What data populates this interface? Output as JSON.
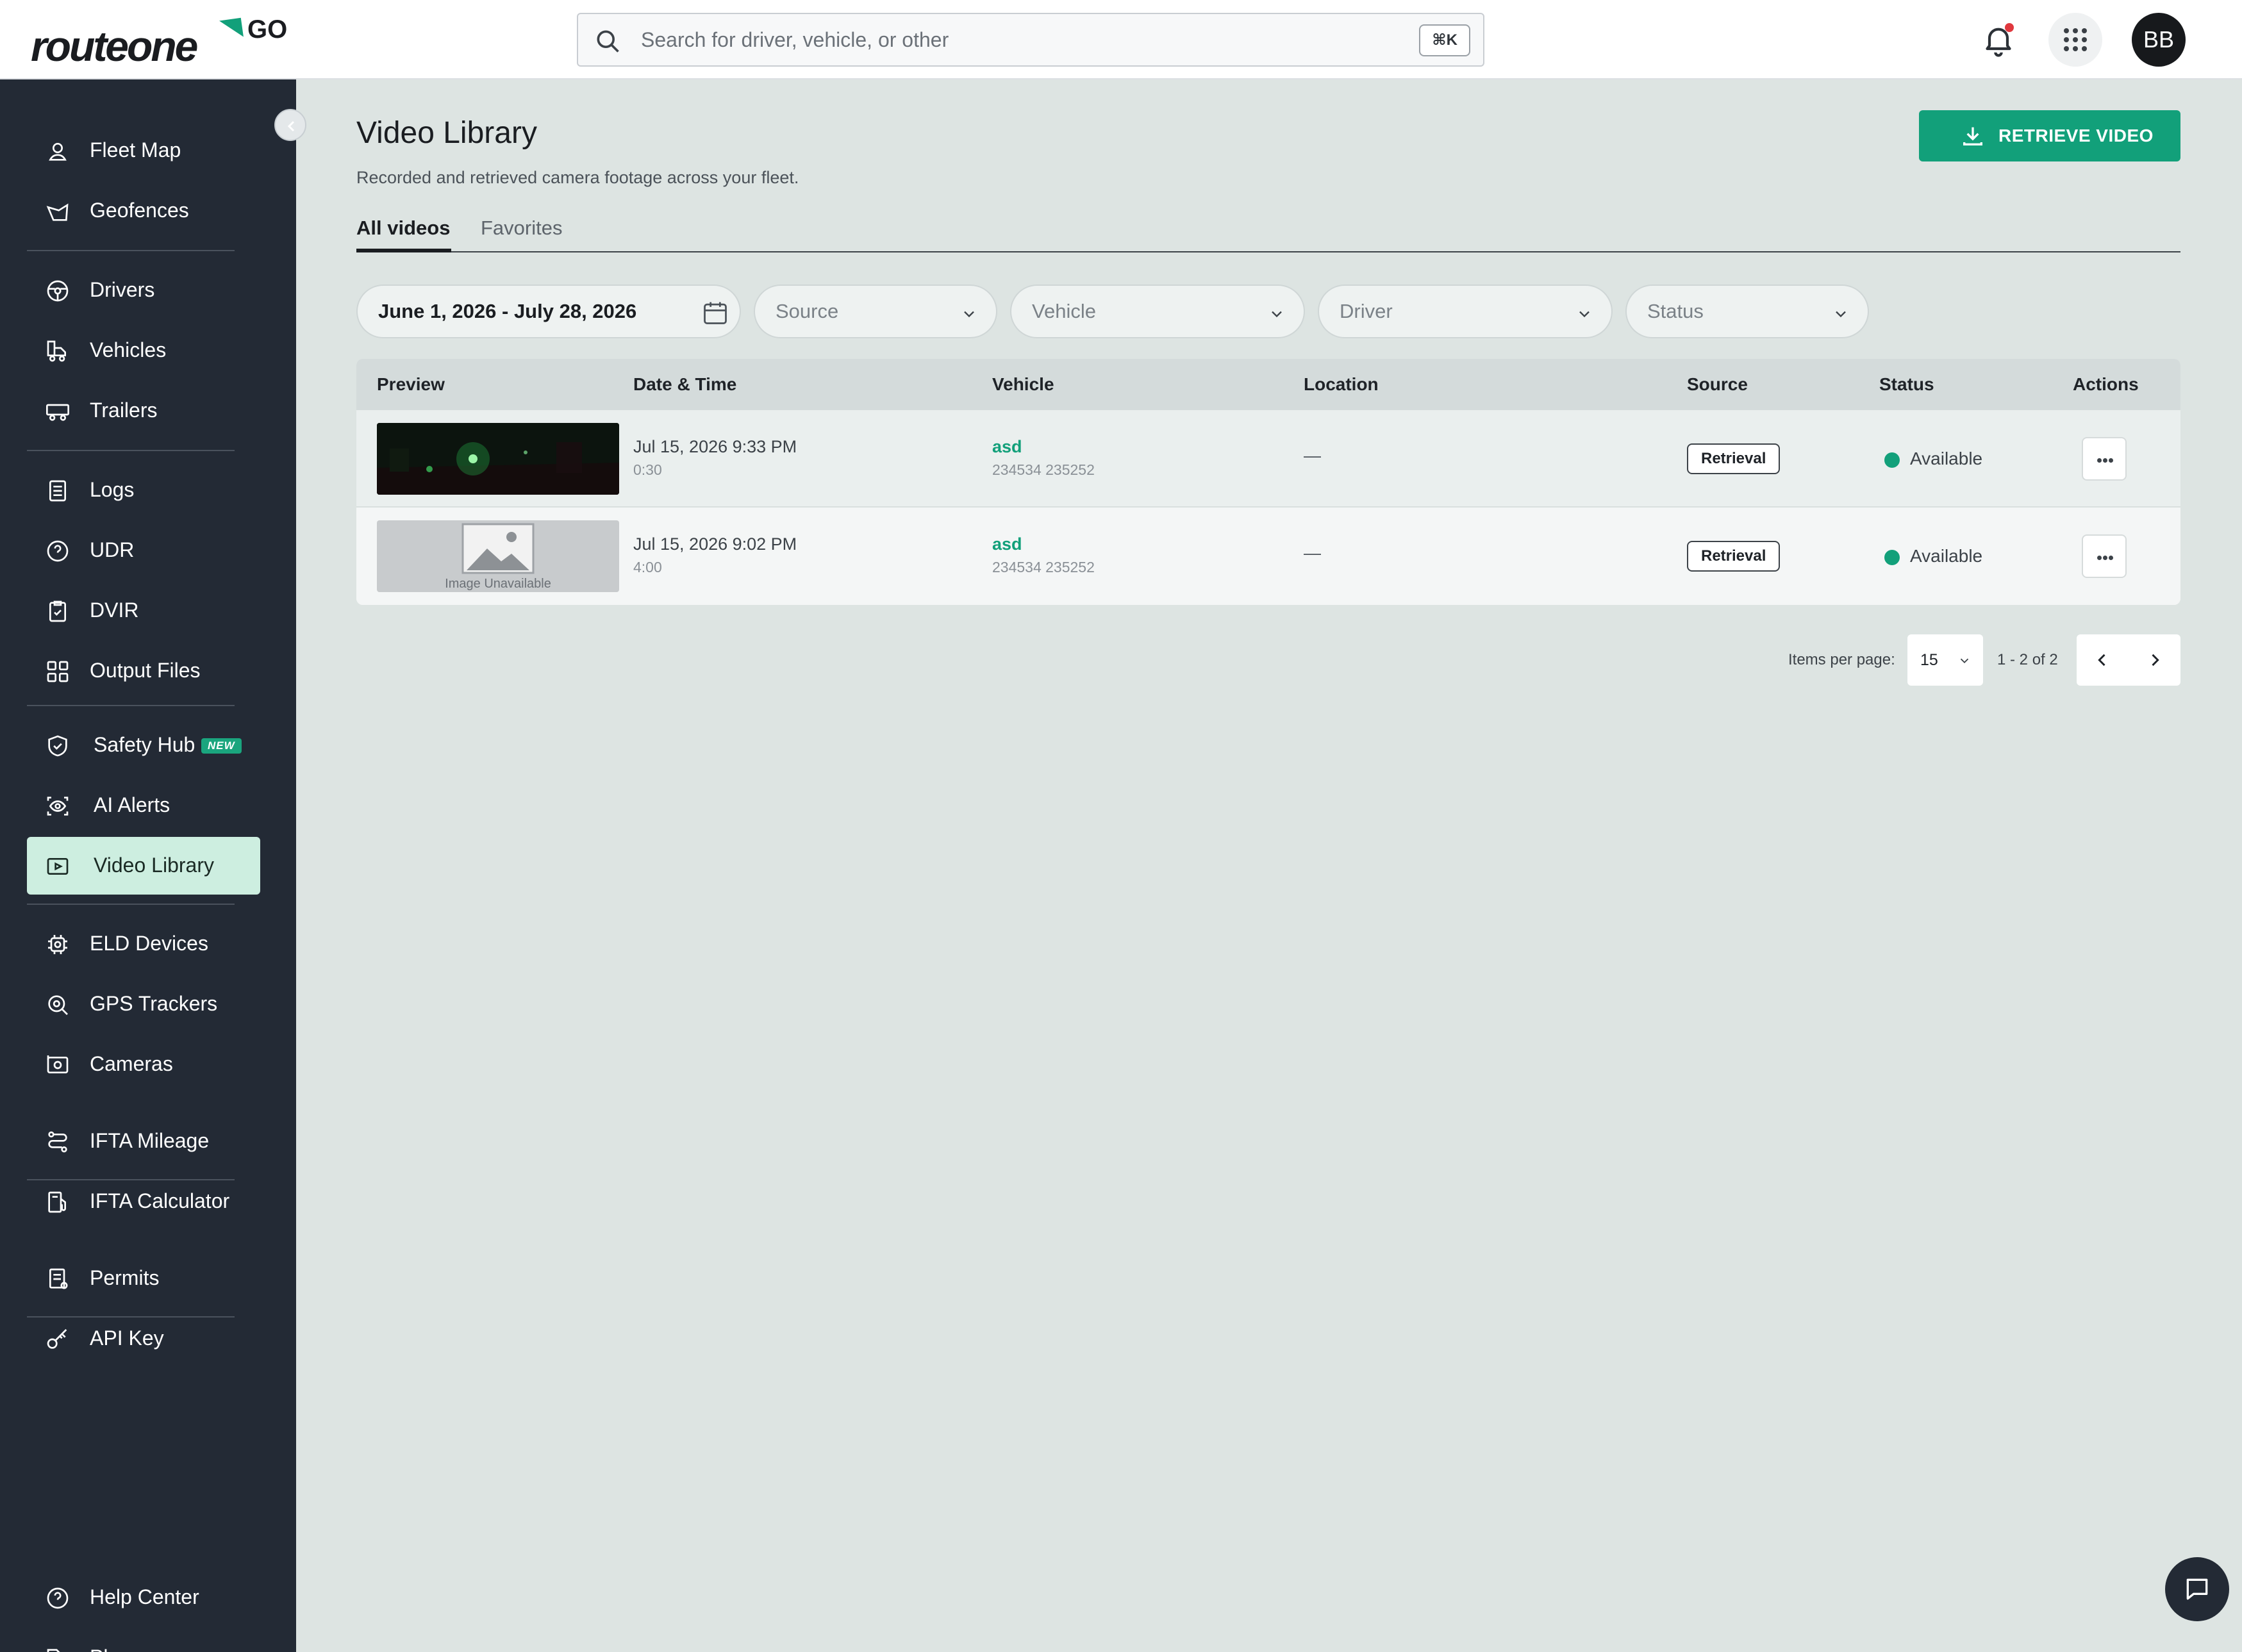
{
  "brand": {
    "wordmark": "routeone",
    "suffix": "GO",
    "accent": "#12a07a"
  },
  "search": {
    "placeholder": "Search for driver, vehicle, or other",
    "shortcut": "⌘K"
  },
  "header": {
    "avatar_initials": "BB"
  },
  "sidebar": {
    "items": [
      {
        "label": "Fleet Map",
        "icon": "map-pin-icon"
      },
      {
        "label": "Geofences",
        "icon": "geofence-icon"
      },
      {
        "label": "Drivers",
        "icon": "steering-wheel-icon"
      },
      {
        "label": "Vehicles",
        "icon": "truck-icon"
      },
      {
        "label": "Trailers",
        "icon": "trailer-icon"
      },
      {
        "label": "Logs",
        "icon": "logs-icon"
      },
      {
        "label": "UDR",
        "icon": "question-icon"
      },
      {
        "label": "DVIR",
        "icon": "clipboard-check-icon"
      },
      {
        "label": "Output Files",
        "icon": "grid-files-icon"
      },
      {
        "label": "Safety Hub",
        "icon": "shield-check-icon",
        "badge": "NEW"
      },
      {
        "label": "AI Alerts",
        "icon": "eye-scan-icon"
      },
      {
        "label": "Video Library",
        "icon": "play-square-icon",
        "active": true
      },
      {
        "label": "ELD Devices",
        "icon": "chip-icon"
      },
      {
        "label": "GPS Trackers",
        "icon": "gps-icon"
      },
      {
        "label": "Cameras",
        "icon": "camera-icon"
      },
      {
        "label": "IFTA Mileage",
        "icon": "route-icon"
      },
      {
        "label": "IFTA Calculator",
        "icon": "fuel-icon"
      },
      {
        "label": "Permits",
        "icon": "permit-icon"
      },
      {
        "label": "API Key",
        "icon": "key-icon"
      },
      {
        "label": "Help Center",
        "icon": "help-icon"
      },
      {
        "label": "Plans",
        "icon": "tag-icon"
      }
    ]
  },
  "page": {
    "title": "Video Library",
    "subtitle": "Recorded and retrieved camera footage across your fleet.",
    "retrieve_button": "RETRIEVE VIDEO",
    "tabs": [
      {
        "label": "All videos",
        "active": true
      },
      {
        "label": "Favorites"
      }
    ]
  },
  "filters": {
    "date_range": "June 1, 2026 - July 28, 2026",
    "source": "Source",
    "vehicle": "Vehicle",
    "driver": "Driver",
    "status": "Status"
  },
  "table": {
    "columns": [
      "Preview",
      "Date & Time",
      "Vehicle",
      "Location",
      "Source",
      "Status",
      "Actions"
    ],
    "rows": [
      {
        "preview": "night-camera-still",
        "datetime": "Jul 15, 2026 9:33 PM",
        "duration": "0:30",
        "vehicle": "asd",
        "vehicle_id": "234534 235252",
        "location": "—",
        "source": "Retrieval",
        "status": "Available"
      },
      {
        "preview": "Image Unavailable",
        "datetime": "Jul 15, 2026 9:02 PM",
        "duration": "4:00",
        "vehicle": "asd",
        "vehicle_id": "234534 235252",
        "location": "—",
        "source": "Retrieval",
        "status": "Available"
      }
    ]
  },
  "pagination": {
    "items_per_page_label": "Items per page:",
    "items_per_page": "15",
    "range": "1 - 2 of 2"
  }
}
